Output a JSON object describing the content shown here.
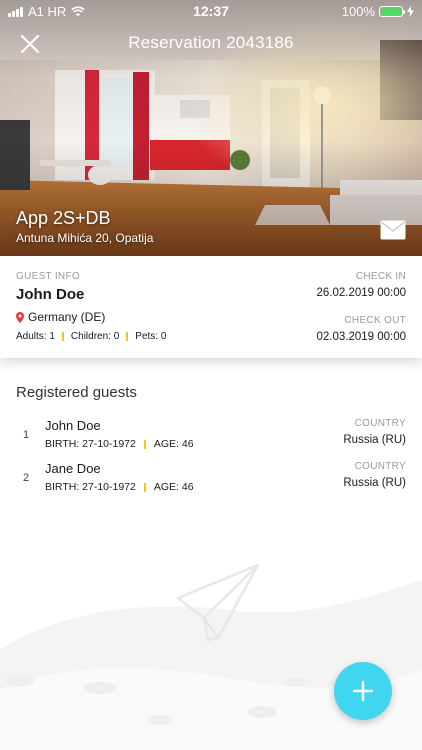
{
  "status_bar": {
    "carrier": "A1 HR",
    "time": "12:37",
    "battery": "100%",
    "battery_level": 1.0
  },
  "header": {
    "title": "Reservation 2043186",
    "close_icon": "close-icon"
  },
  "unit": {
    "name": "App 2S+DB",
    "address": "Antuna Mihića 20, Opatija",
    "mail_icon": "envelope-icon"
  },
  "guest_info": {
    "label": "GUEST INFO",
    "name": "John Doe",
    "country": "Germany (DE)",
    "adults": "Adults: 1",
    "children": "Children: 0",
    "pets": "Pets: 0"
  },
  "check_in": {
    "label": "CHECK IN",
    "value": "26.02.2019 00:00"
  },
  "check_out": {
    "label": "CHECK OUT",
    "value": "02.03.2019 00:00"
  },
  "registered": {
    "title": "Registered guests",
    "guests": [
      {
        "index": "1",
        "name": "John Doe",
        "birth": "BIRTH: 27-10-1972",
        "age": "AGE: 46",
        "country_label": "COUNTRY",
        "country": "Russia (RU)"
      },
      {
        "index": "2",
        "name": "Jane Doe",
        "birth": "BIRTH: 27-10-1972",
        "age": "AGE: 46",
        "country_label": "COUNTRY",
        "country": "Russia (RU)"
      }
    ]
  },
  "colors": {
    "accent": "#41d6ef",
    "separator": "#f5c518",
    "location_pin": "#e53935"
  },
  "fab": {
    "icon": "plus-icon"
  }
}
